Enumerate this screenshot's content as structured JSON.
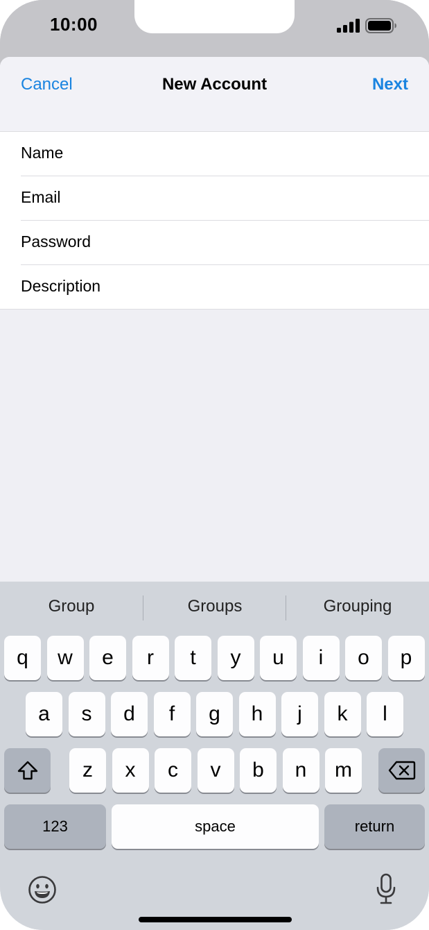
{
  "status": {
    "time": "10:00",
    "signal_icon": "cellular-signal-icon",
    "battery_icon": "battery-icon"
  },
  "nav": {
    "cancel_label": "Cancel",
    "title": "New Account",
    "next_label": "Next",
    "accent_color": "#1a84e0"
  },
  "form": {
    "fields": [
      {
        "label": "Name",
        "value": ""
      },
      {
        "label": "Email",
        "value": ""
      },
      {
        "label": "Password",
        "value": ""
      },
      {
        "label": "Description",
        "value": ""
      }
    ]
  },
  "keyboard": {
    "suggestions": [
      "Group",
      "Groups",
      "Grouping"
    ],
    "row1": [
      "q",
      "w",
      "e",
      "r",
      "t",
      "y",
      "u",
      "i",
      "o",
      "p"
    ],
    "row2": [
      "a",
      "s",
      "d",
      "f",
      "g",
      "h",
      "j",
      "k",
      "l"
    ],
    "row3": [
      "z",
      "x",
      "c",
      "v",
      "b",
      "n",
      "m"
    ],
    "shift_icon": "shift-icon",
    "delete_icon": "delete-backspace-icon",
    "numbers_label": "123",
    "space_label": "space",
    "return_label": "return",
    "emoji_icon": "emoji-icon",
    "mic_icon": "microphone-icon"
  }
}
